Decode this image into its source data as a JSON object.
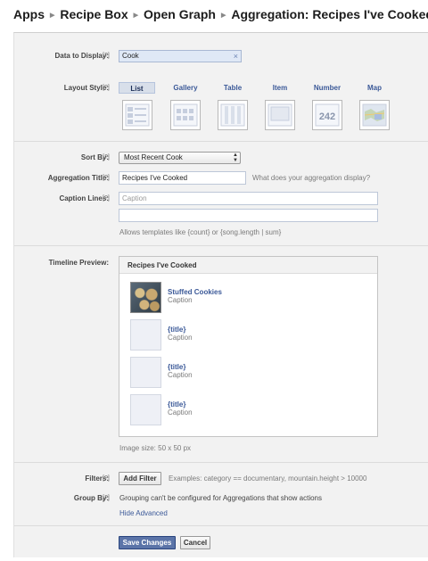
{
  "breadcrumb": {
    "items": [
      "Apps",
      "Recipe Box",
      "Open Graph",
      "Aggregation: Recipes I've Cooked"
    ]
  },
  "help_marker": "[?]",
  "data_to_display": {
    "label": "Data to Display:",
    "value": "Cook",
    "clear_icon": "×"
  },
  "layout_style": {
    "label": "Layout Style:",
    "selected": "List",
    "options": [
      "List",
      "Gallery",
      "Table",
      "Item",
      "Number",
      "Map"
    ],
    "number_thumb_text": "242"
  },
  "sort_by": {
    "label": "Sort By:",
    "value": "Most Recent Cook",
    "arrows": "▲▼"
  },
  "aggregation_title": {
    "label": "Aggregation Title:",
    "value": "Recipes I've Cooked",
    "hint": "What does your aggregation display?"
  },
  "caption_lines": {
    "label": "Caption Lines:",
    "line1_placeholder": "Caption",
    "line2_placeholder": "",
    "hint": "Allows templates like {count} or {song.length | sum}"
  },
  "timeline_preview": {
    "label": "Timeline Preview:",
    "header": "Recipes I've Cooked",
    "items": [
      {
        "title": "Stuffed Cookies",
        "caption": "Caption"
      },
      {
        "title": "{title}",
        "caption": "Caption"
      },
      {
        "title": "{title}",
        "caption": "Caption"
      },
      {
        "title": "{title}",
        "caption": "Caption"
      }
    ],
    "image_size": "Image size: 50 x 50 px"
  },
  "filters": {
    "label": "Filters:",
    "button": "Add Filter",
    "examples": "Examples: category == documentary, mountain.height > 10000"
  },
  "group_by": {
    "label": "Group By:",
    "text": "Grouping can't be configured for Aggregations that show actions"
  },
  "hide_advanced": "Hide Advanced",
  "actions": {
    "save": "Save Changes",
    "cancel": "Cancel"
  },
  "colors": {
    "link": "#3b5998",
    "panel": "#f2f2f2",
    "button_blue": "#5b74a8"
  }
}
